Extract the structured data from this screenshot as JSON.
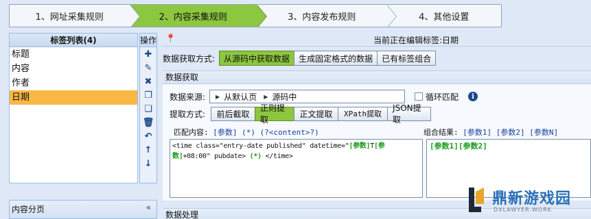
{
  "wizard": {
    "steps": [
      {
        "label": "1、网址采集规则"
      },
      {
        "label": "2、内容采集规则"
      },
      {
        "label": "3、内容发布规则"
      },
      {
        "label": "4、其他设置"
      }
    ],
    "active_index": 1,
    "active_color": "#8dc63f"
  },
  "taglist": {
    "title": "标签列表(4)",
    "items": [
      "标题",
      "内容",
      "作者",
      "日期"
    ],
    "selected": "日期",
    "selected_color": "#f9b844"
  },
  "ops": {
    "title": "操作",
    "tools": [
      {
        "icon": "plus-icon",
        "glyph": "✚"
      },
      {
        "icon": "pencil-icon",
        "glyph": "✎"
      },
      {
        "icon": "close-icon",
        "glyph": "✖"
      },
      {
        "icon": "copy-icon",
        "glyph": "❐"
      },
      {
        "icon": "paste-icon",
        "glyph": "❏"
      },
      {
        "icon": "trash-icon",
        "glyph": "🗑"
      },
      {
        "icon": "undo-icon",
        "glyph": "↶"
      },
      {
        "icon": "arrow-up-icon",
        "glyph": "↑"
      },
      {
        "icon": "arrow-down-icon",
        "glyph": "↓"
      }
    ]
  },
  "pager": {
    "title": "内容分页",
    "chevron": "«"
  },
  "editing": {
    "pin": "📍",
    "text": "当前正在编辑标签:日期"
  },
  "mode": {
    "label": "数据获取方式:",
    "options": [
      "从源码中获取数据",
      "生成固定格式的数据",
      "已有标签组合"
    ],
    "active": "从源码中获取数据"
  },
  "acquire": {
    "section_title": "数据获取",
    "source_label": "数据来源:",
    "source_path": [
      "从默认页",
      "源码中"
    ],
    "loop_label": "循环匹配",
    "info": "i",
    "extract_label": "提取方式:",
    "extract_options": [
      "前后截取",
      "正则提取",
      "正文提取",
      "XPath提取",
      "JSON提取"
    ],
    "extract_active": "正则提取",
    "match_label": "匹配内容:",
    "match_tokens": [
      "[参数]",
      "(*)",
      "(?<content>?)"
    ],
    "match_content": {
      "part1": "<time class=\"entry-date published\" datetime=\"",
      "p1": "[参数]",
      "mid": "T",
      "p2": "[参数]",
      "part2": "+08:00\" pubdate> ",
      "star": "(*)",
      "part3": " </time>"
    },
    "result_label": "组合结果:",
    "result_tokens": [
      "[参数1]",
      "[参数2]",
      "[参数N]"
    ],
    "result_content": "[参数1][参数2]"
  },
  "process": {
    "section_title": "数据处理"
  },
  "watermark": {
    "name": "鼎新游戏园",
    "url": "DXLAWYER.WORK"
  }
}
